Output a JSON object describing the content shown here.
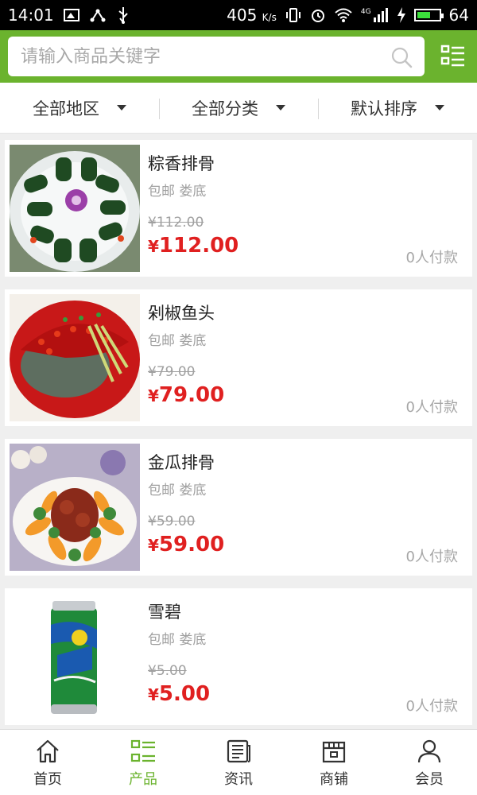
{
  "status_bar": {
    "time": "14:01",
    "net_speed": "405",
    "net_unit": "K/s",
    "signal_label": "4G",
    "battery": "64",
    "battery_fraction": 0.64
  },
  "search": {
    "placeholder": "请输入商品关键字"
  },
  "filters": [
    {
      "label": "全部地区"
    },
    {
      "label": "全部分类"
    },
    {
      "label": "默认排序"
    }
  ],
  "products": [
    {
      "name": "粽香排骨",
      "shipping": "包邮 娄底",
      "old_price": "¥112.00",
      "price_symbol": "¥",
      "price": "112.00",
      "paid": "0人付款",
      "image": "ribs-leaf-wrap"
    },
    {
      "name": "剁椒鱼头",
      "shipping": "包邮 娄底",
      "old_price": "¥79.00",
      "price_symbol": "¥",
      "price": "79.00",
      "paid": "0人付款",
      "image": "chili-fish-head"
    },
    {
      "name": "金瓜排骨",
      "shipping": "包邮 娄底",
      "old_price": "¥59.00",
      "price_symbol": "¥",
      "price": "59.00",
      "paid": "0人付款",
      "image": "pumpkin-ribs"
    },
    {
      "name": "雪碧",
      "shipping": "包邮 娄底",
      "old_price": "¥5.00",
      "price_symbol": "¥",
      "price": "5.00",
      "paid": "0人付款",
      "image": "sprite-can"
    }
  ],
  "bottom_nav": [
    {
      "label": "首页",
      "icon": "home-icon",
      "active": false
    },
    {
      "label": "产品",
      "icon": "list-grid-icon",
      "active": true
    },
    {
      "label": "资讯",
      "icon": "news-icon",
      "active": false
    },
    {
      "label": "商铺",
      "icon": "store-icon",
      "active": false
    },
    {
      "label": "会员",
      "icon": "user-icon",
      "active": false
    }
  ],
  "colors": {
    "brand_green": "#6bb32e",
    "price_red": "#e02020"
  }
}
